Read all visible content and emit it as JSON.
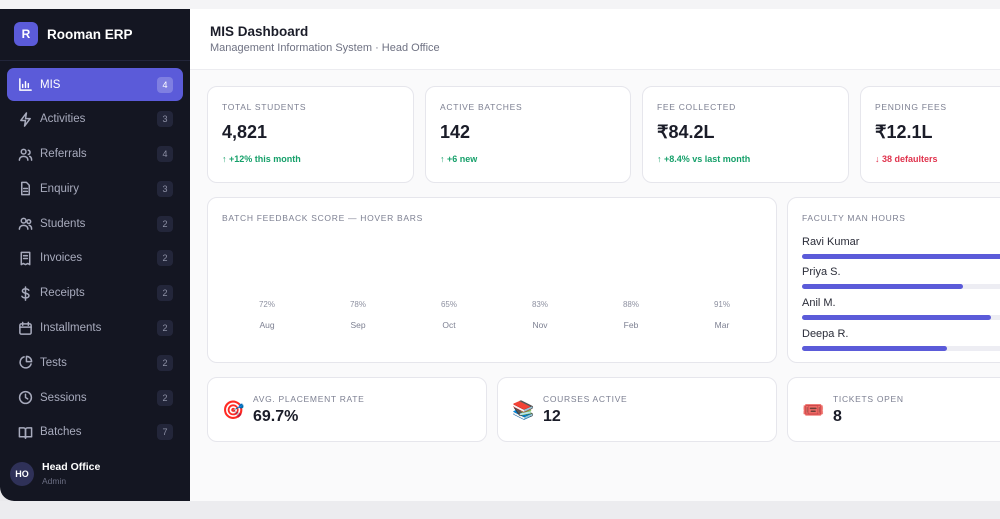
{
  "app": {
    "logo_letter": "R",
    "name": "Rooman ERP"
  },
  "sidebar": {
    "items": [
      {
        "label": "MIS",
        "count": "4",
        "icon": "bar-chart-icon",
        "active": true
      },
      {
        "label": "Activities",
        "count": "3",
        "icon": "activity-icon"
      },
      {
        "label": "Referrals",
        "count": "4",
        "icon": "users-icon"
      },
      {
        "label": "Enquiry",
        "count": "3",
        "icon": "document-icon"
      },
      {
        "label": "Students",
        "count": "2",
        "icon": "students-icon"
      },
      {
        "label": "Invoices",
        "count": "2",
        "icon": "invoice-icon"
      },
      {
        "label": "Receipts",
        "count": "2",
        "icon": "dollar-icon"
      },
      {
        "label": "Installments",
        "count": "2",
        "icon": "calendar-icon"
      },
      {
        "label": "Tests",
        "count": "2",
        "icon": "pie-icon"
      },
      {
        "label": "Sessions",
        "count": "2",
        "icon": "clock-icon"
      },
      {
        "label": "Batches",
        "count": "7",
        "icon": "book-icon"
      }
    ],
    "user": {
      "initials": "HO",
      "name": "Head Office",
      "role": "Admin"
    }
  },
  "header": {
    "title": "MIS Dashboard",
    "subtitle": "Management Information System · Head Office"
  },
  "stats": [
    {
      "label": "TOTAL STUDENTS",
      "value": "4,821",
      "delta": "↑ +12% this month",
      "trend": "up"
    },
    {
      "label": "ACTIVE BATCHES",
      "value": "142",
      "delta": "↑ +6 new",
      "trend": "up"
    },
    {
      "label": "FEE COLLECTED",
      "value": "₹84.2L",
      "delta": "↑ +8.4% vs last month",
      "trend": "up"
    },
    {
      "label": "PENDING FEES",
      "value": "₹12.1L",
      "delta": "↓ 38 defaulters",
      "trend": "down"
    }
  ],
  "feedback": {
    "title": "BATCH FEEDBACK SCORE — HOVER BARS",
    "chart_data": {
      "type": "bar",
      "categories": [
        "Aug",
        "Sep",
        "Oct",
        "Nov",
        "Feb",
        "Mar"
      ],
      "value_labels": [
        "72%",
        "78%",
        "65%",
        "83%",
        "88%",
        "91%"
      ],
      "values": [
        72,
        78,
        65,
        83,
        88,
        91
      ]
    }
  },
  "faculty": {
    "title": "FACULTY MAN HOURS",
    "rows": [
      {
        "name": "Ravi Kumar",
        "fraction": 0.97
      },
      {
        "name": "Priya S.",
        "fraction": 0.73
      },
      {
        "name": "Anil M.",
        "fraction": 0.86
      },
      {
        "name": "Deepa R.",
        "fraction": 0.66
      }
    ]
  },
  "mini_stats": [
    {
      "icon": "🎯",
      "icon_name": "target-icon",
      "label": "AVG. PLACEMENT RATE",
      "value": "69.7%"
    },
    {
      "icon": "📚",
      "icon_name": "books-icon",
      "label": "COURSES ACTIVE",
      "value": "12"
    },
    {
      "icon": "🎟️",
      "icon_name": "ticket-icon",
      "label": "TICKETS OPEN",
      "value": "8"
    }
  ],
  "colors": {
    "accent": "#5b5bd9",
    "sidebar_bg": "#141622",
    "up": "#16a06a",
    "down": "#e0334d"
  }
}
